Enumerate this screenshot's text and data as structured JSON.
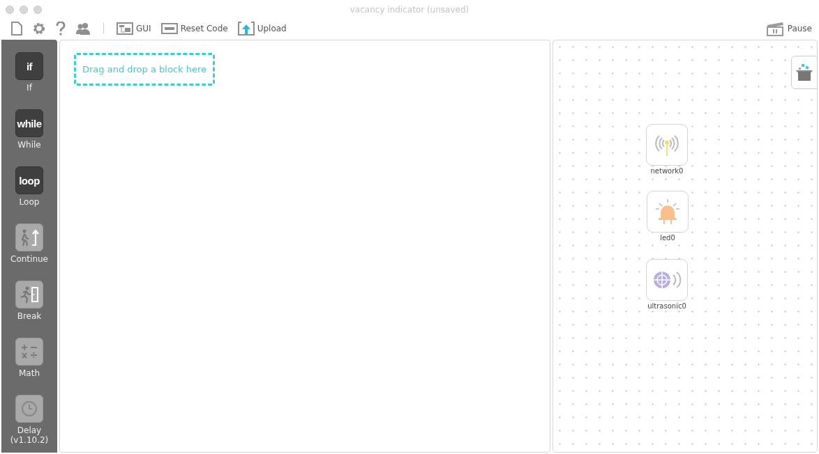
{
  "window": {
    "title": "vacancy indicator (unsaved)"
  },
  "toolbar": {
    "buttons": [
      {
        "kind": "new"
      },
      {
        "kind": "settings"
      },
      {
        "kind": "help"
      },
      {
        "kind": "users"
      },
      {
        "kind": "gui",
        "label": "GUI"
      },
      {
        "kind": "reset",
        "label": "Reset Code"
      },
      {
        "kind": "upload",
        "label": "Upload"
      }
    ],
    "pause": {
      "label": "Pause"
    }
  },
  "sidebar": {
    "blocks": [
      {
        "kind": "text",
        "glyph": "if",
        "label": "If",
        "disabled": false
      },
      {
        "kind": "text",
        "glyph": "while",
        "label": "While",
        "disabled": false
      },
      {
        "kind": "text",
        "glyph": "loop",
        "label": "Loop",
        "disabled": false
      },
      {
        "kind": "continue",
        "label": "Continue",
        "disabled": true
      },
      {
        "kind": "break",
        "label": "Break",
        "disabled": true
      },
      {
        "kind": "math",
        "label": "Math",
        "disabled": true
      },
      {
        "kind": "delay",
        "label": "Delay",
        "disabled": true
      }
    ],
    "version": "(v1.10.2)"
  },
  "code_area": {
    "placeholder": "Drag and drop a block here"
  },
  "device_panel": {
    "devices": [
      {
        "kind": "network",
        "name": "network0"
      },
      {
        "kind": "led",
        "name": "led0"
      },
      {
        "kind": "ultrasonic",
        "name": "ultrasonic0"
      }
    ]
  }
}
